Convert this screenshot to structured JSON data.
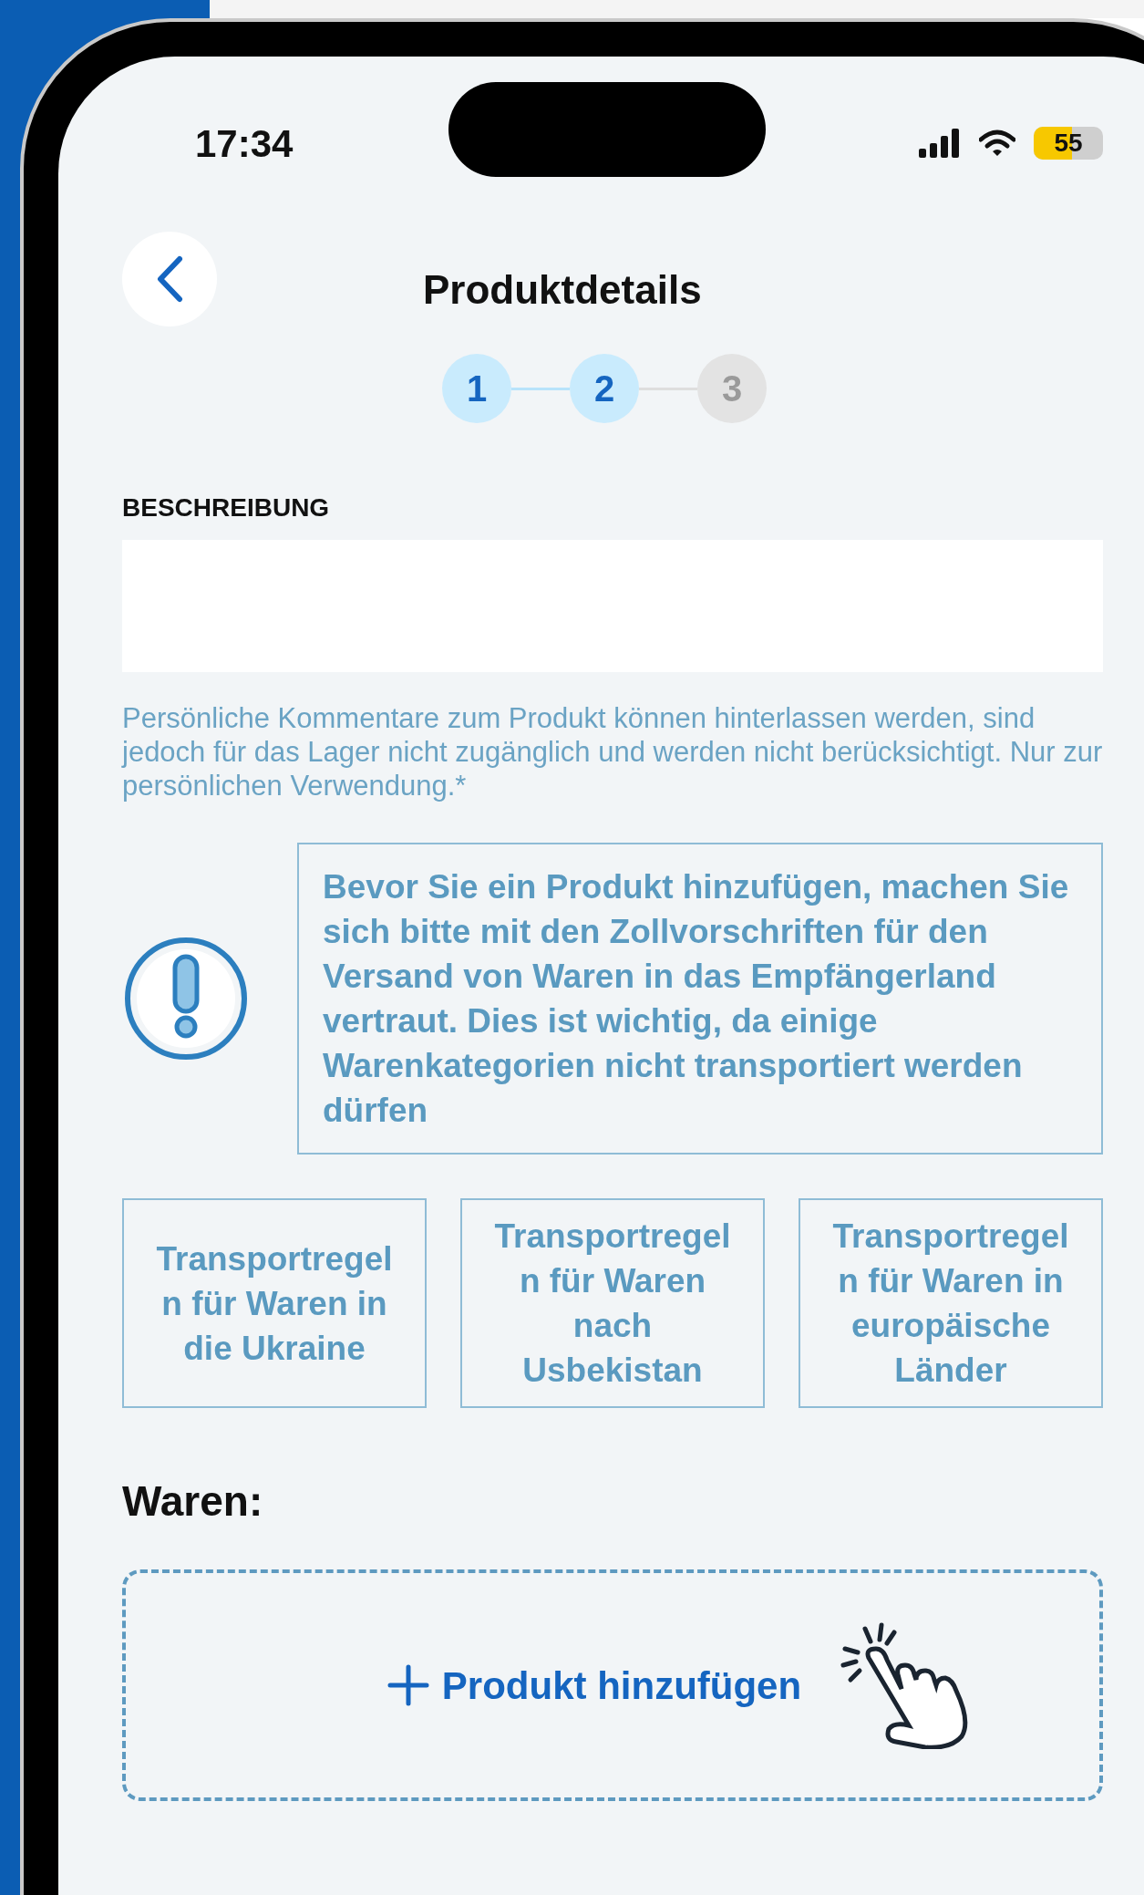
{
  "status_bar": {
    "time": "17:34",
    "battery": {
      "label": "55",
      "level": 0.55
    }
  },
  "header": {
    "title": "Produktdetails"
  },
  "steps": [
    {
      "label": "1",
      "active": true
    },
    {
      "label": "2",
      "active": true
    },
    {
      "label": "3",
      "active": false
    }
  ],
  "description": {
    "label": "BESCHREIBUNG",
    "hint": "Persönliche Kommentare zum Produkt können hinterlassen werden, sind jedoch für das Lager nicht zugänglich und werden nicht berücksichtigt. Nur zur persönlichen Verwendung.*"
  },
  "warning": {
    "text": "Bevor Sie ein Produkt hinzufügen, machen Sie sich bitte mit den Zollvorschriften für den Versand von Waren in das Empfängerland vertraut. Dies ist wichtig, da einige Warenkategorien nicht transportiert werden dürfen"
  },
  "rule_links": [
    "Transportregel n für Waren in die Ukraine",
    "Transportregel n für Waren nach Usbekistan",
    "Transportregel n für Waren in europäische Länder"
  ],
  "goods": {
    "heading": "Waren:",
    "add_button": "Produkt hinzufügen"
  }
}
